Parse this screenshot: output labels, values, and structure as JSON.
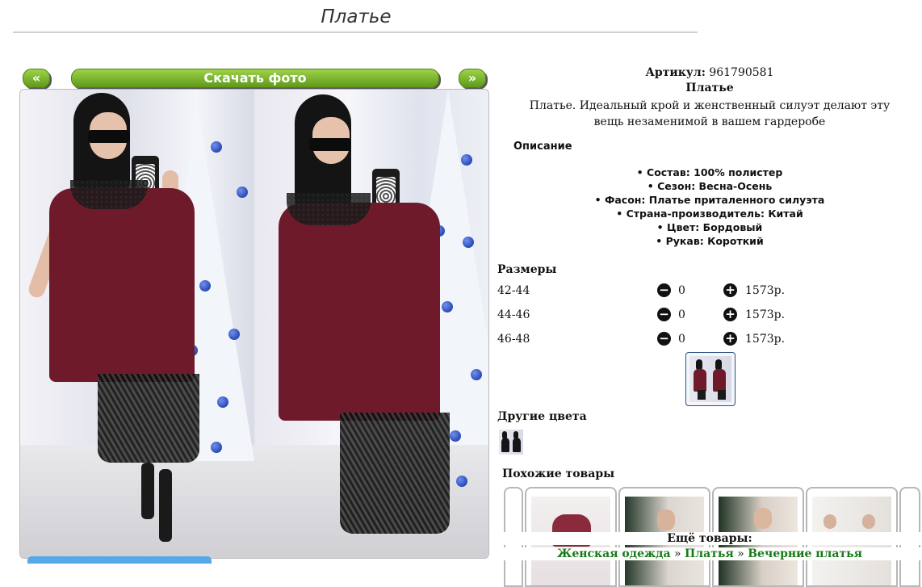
{
  "page": {
    "title": "Платье"
  },
  "gallery": {
    "prev_label": "«",
    "download_label": "Скачать фото",
    "next_label": "»"
  },
  "product": {
    "article_label": "Артикул:",
    "article_value": "961790581",
    "name": "Платье",
    "short_description": "Платье. Идеальный крой и женственный силуэт делают эту вещь незаменимой в вашем гардеробе",
    "description_heading": "Описание",
    "properties": [
      "Состав: 100% полистер",
      "Сезон: Весна-Осень",
      "Фасон: Платье приталенного силуэта",
      "Страна-производитель: Китай",
      "Цвет: Бордовый",
      "Рукав: Короткий"
    ]
  },
  "sizes": {
    "heading": "Размеры",
    "rows": [
      {
        "size": "42-44",
        "qty": "0",
        "price": "1573р."
      },
      {
        "size": "44-46",
        "qty": "0",
        "price": "1573р."
      },
      {
        "size": "46-48",
        "qty": "0",
        "price": "1573р."
      }
    ],
    "minus_icon": "minus-circle-icon",
    "plus_icon": "plus-circle-icon"
  },
  "other_colors": {
    "heading": "Другие цвета"
  },
  "similar": {
    "heading": "Похожие товары"
  },
  "more": {
    "heading": "Ещё товары:",
    "breadcrumb": [
      "Женская одежда",
      "Платья",
      "Вечерние платья"
    ],
    "separator": "»"
  },
  "colors": {
    "button_green_top": "#9ed24a",
    "button_green_bottom": "#5e9a18",
    "link_green": "#177a17",
    "dress_burgundy": "#6e1a2a",
    "scroll_blue": "#54a9e6"
  }
}
